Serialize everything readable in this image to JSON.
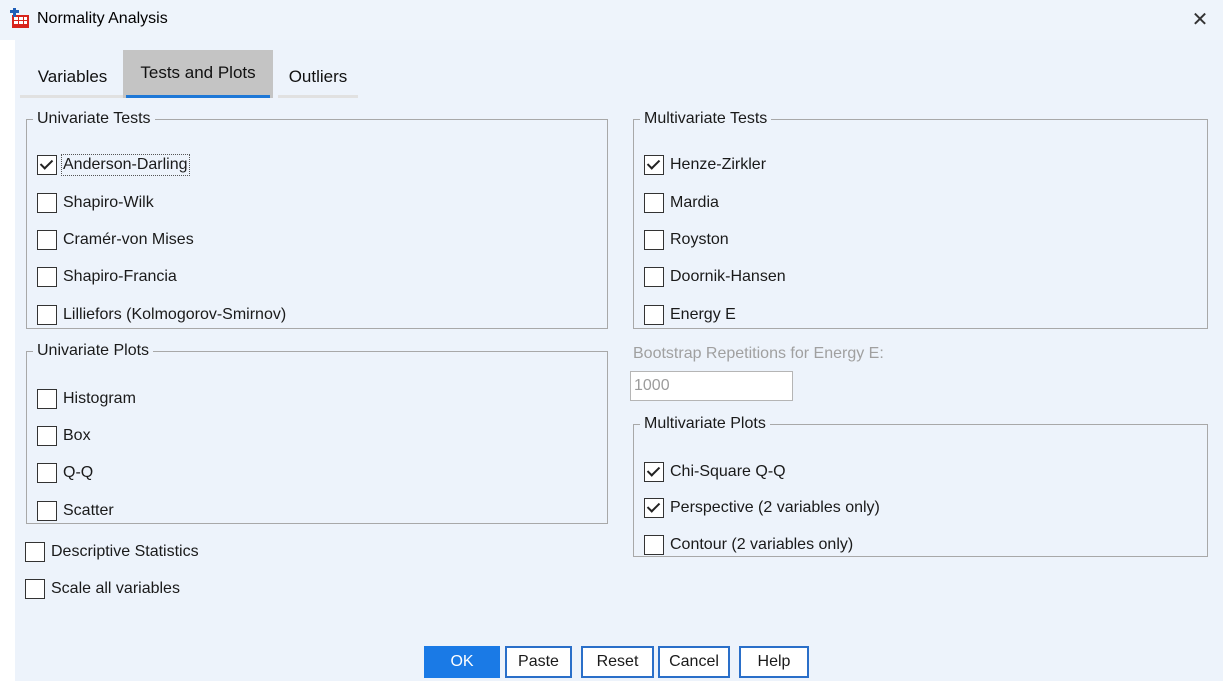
{
  "window": {
    "title": "Normality Analysis",
    "close_glyph": "✕"
  },
  "tabs": [
    {
      "label": "Variables",
      "active": false
    },
    {
      "label": "Tests and Plots",
      "active": true
    },
    {
      "label": "Outliers",
      "active": false
    }
  ],
  "univariate_tests": {
    "legend": "Univariate Tests",
    "items": [
      {
        "label": "Anderson-Darling",
        "checked": true
      },
      {
        "label": "Shapiro-Wilk",
        "checked": false
      },
      {
        "label": "Cramér-von Mises",
        "checked": false
      },
      {
        "label": "Shapiro-Francia",
        "checked": false
      },
      {
        "label": "Lilliefors (Kolmogorov-Smirnov)",
        "checked": false
      }
    ]
  },
  "univariate_plots": {
    "legend": "Univariate Plots",
    "items": [
      {
        "label": "Histogram",
        "checked": false
      },
      {
        "label": "Box",
        "checked": false
      },
      {
        "label": "Q-Q",
        "checked": false
      },
      {
        "label": "Scatter",
        "checked": false
      }
    ]
  },
  "options": {
    "descriptive_statistics": {
      "label": "Descriptive Statistics",
      "checked": false
    },
    "scale_all_variables": {
      "label": "Scale all variables",
      "checked": false
    }
  },
  "multivariate_tests": {
    "legend": "Multivariate Tests",
    "items": [
      {
        "label": "Henze-Zirkler",
        "checked": true
      },
      {
        "label": "Mardia",
        "checked": false
      },
      {
        "label": "Royston",
        "checked": false
      },
      {
        "label": "Doornik-Hansen",
        "checked": false
      },
      {
        "label": "Energy E",
        "checked": false
      }
    ]
  },
  "bootstrap": {
    "label": "Bootstrap Repetitions for Energy E:",
    "value": "1000"
  },
  "multivariate_plots": {
    "legend": "Multivariate Plots",
    "items": [
      {
        "label": "Chi-Square Q-Q",
        "checked": true
      },
      {
        "label": "Perspective (2 variables only)",
        "checked": true
      },
      {
        "label": "Contour (2 variables only)",
        "checked": false
      }
    ]
  },
  "buttons": {
    "ok": "OK",
    "paste": "Paste",
    "reset": "Reset",
    "cancel": "Cancel",
    "help": "Help"
  },
  "colors": {
    "accent": "#1a7ae6",
    "client_background": "#edf3fb"
  }
}
